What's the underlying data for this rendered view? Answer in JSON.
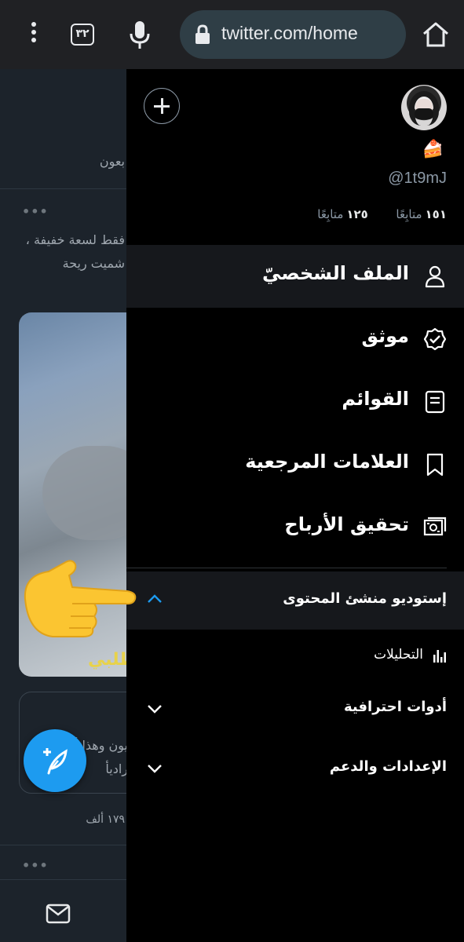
{
  "browser": {
    "tab_count": "٣٢",
    "url": "twitter.com/home",
    "icons": [
      "menu-dots-icon",
      "tabs-icon",
      "mic-icon",
      "lock-icon",
      "home-icon"
    ]
  },
  "feed": {
    "header_fragment": "بعون",
    "post_text_line1": "فقط لسعة خفيفة ،",
    "post_text_line2": "شميت ريحة",
    "media_caption": "طلبي",
    "card_text_line1": "يون وهذا أرعب",
    "card_text_line2": "راديأ",
    "stat_fragment": "١٧٩ ألف",
    "more": "•••"
  },
  "drawer": {
    "handle": "@1t9mJ",
    "cake": "🍰",
    "following_count": "١٥١",
    "following_label": "متابِعًا",
    "followers_count": "١٢٥",
    "followers_label": "متابِعًا",
    "nav": [
      {
        "label": "الملف الشخصيّ",
        "icon": "person-icon",
        "active": true
      },
      {
        "label": "موثق",
        "icon": "verified-icon"
      },
      {
        "label": "القوائم",
        "icon": "lists-icon"
      },
      {
        "label": "العلامات المرجعية",
        "icon": "bookmark-icon"
      },
      {
        "label": "تحقيق الأرباح",
        "icon": "money-icon"
      }
    ],
    "studio": {
      "label": "إستوديو منشئ المحتوى",
      "expanded": true
    },
    "studio_items": [
      {
        "label": "التحليلات",
        "icon": "analytics-icon"
      }
    ],
    "accordions": [
      {
        "label": "أدوات احترافية"
      },
      {
        "label": "الإعدادات والدعم"
      }
    ]
  },
  "colors": {
    "accent": "#1d9bf0",
    "drawer_bg": "#000000",
    "active_row": "#16181c",
    "chrome_bg": "#202124"
  }
}
